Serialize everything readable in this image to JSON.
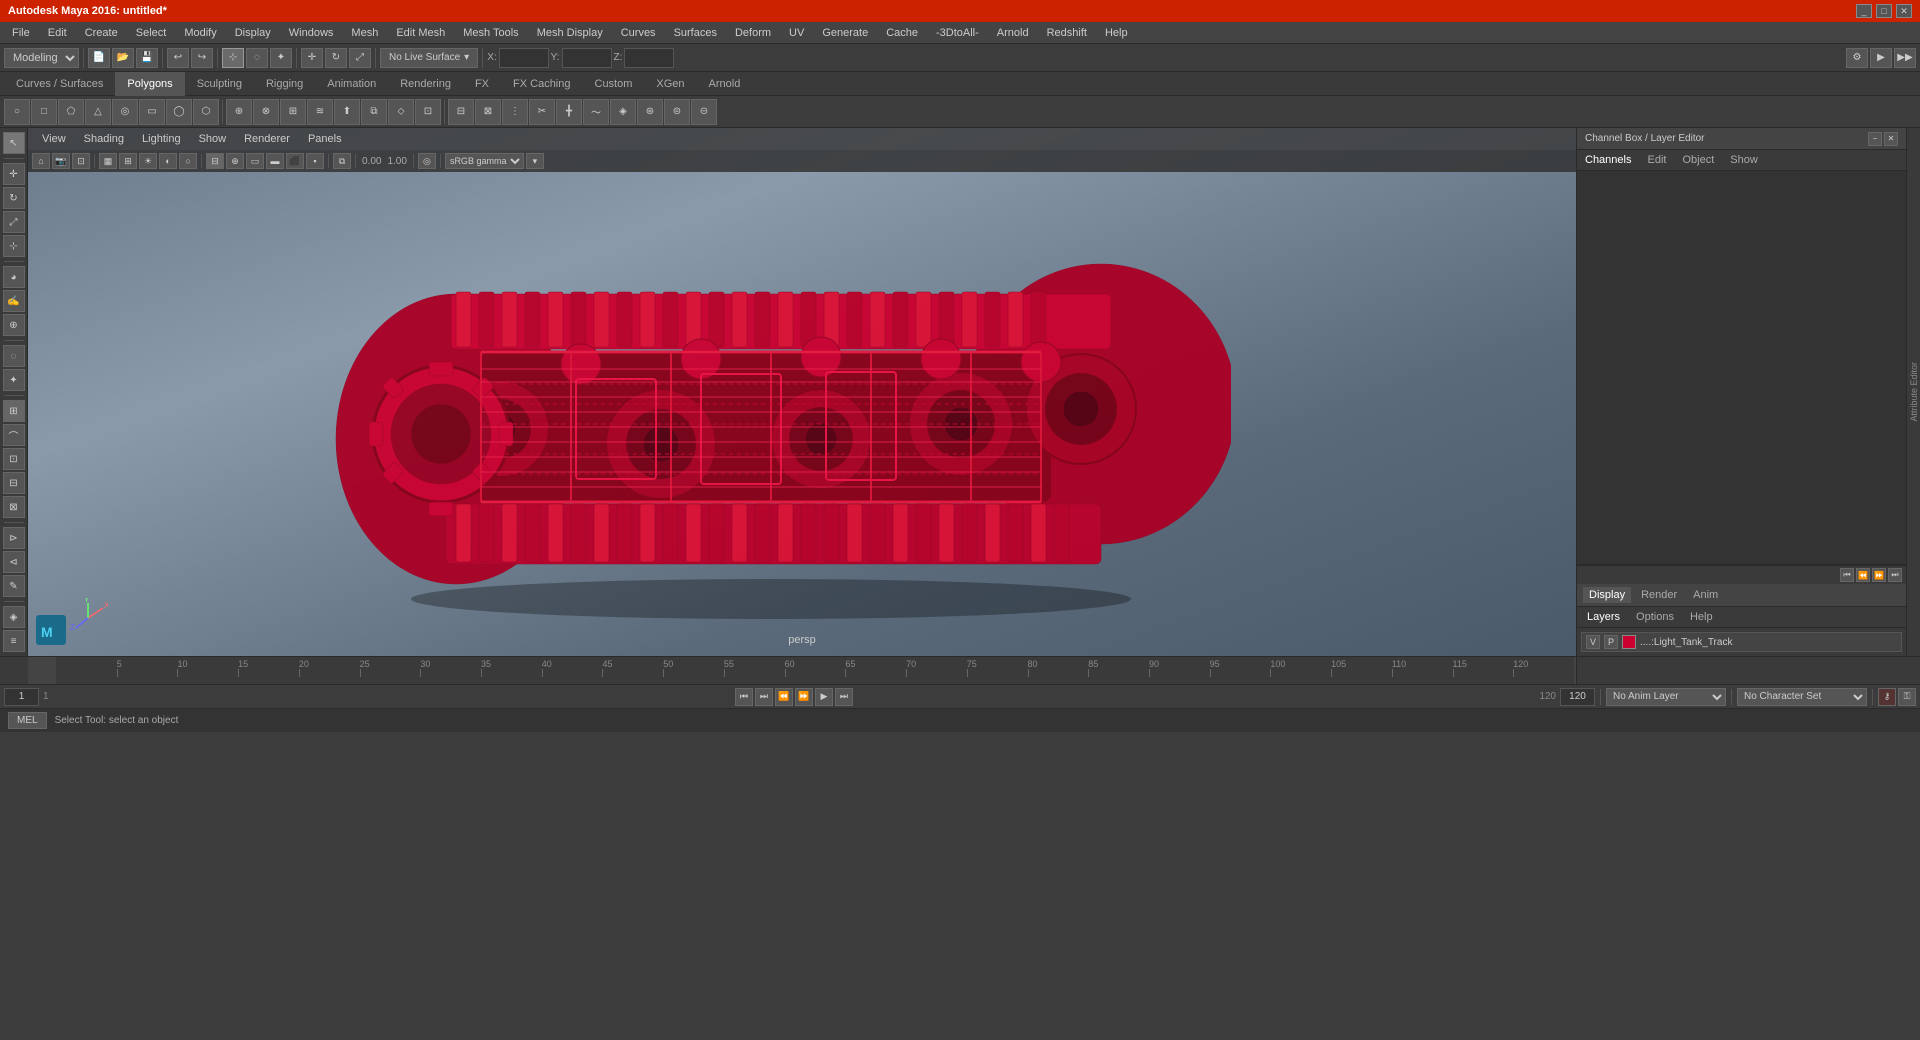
{
  "app": {
    "title": "Autodesk Maya 2016: untitled*",
    "window_controls": [
      "minimize",
      "maximize",
      "close"
    ]
  },
  "menu_bar": {
    "items": [
      "File",
      "Edit",
      "Create",
      "Select",
      "Modify",
      "Display",
      "Windows",
      "Mesh",
      "Edit Mesh",
      "Mesh Tools",
      "Mesh Display",
      "Curves",
      "Surfaces",
      "Deform",
      "UV",
      "Generate",
      "Cache",
      "-3DtoAll-",
      "Arnold",
      "Redshift",
      "Help"
    ]
  },
  "toolbar1": {
    "mode_select": "Modeling",
    "no_live_surface": "No Live Surface",
    "xyz_labels": [
      "X:",
      "Y:",
      "Z:"
    ],
    "custom_label": "Custom"
  },
  "tabs": {
    "items": [
      "Curves / Surfaces",
      "Polygons",
      "Sculpting",
      "Rigging",
      "Animation",
      "Rendering",
      "FX",
      "FX Caching",
      "Custom",
      "XGen",
      "Arnold"
    ]
  },
  "viewport": {
    "menu_items": [
      "View",
      "Shading",
      "Lighting",
      "Show",
      "Renderer",
      "Panels"
    ],
    "label": "persp",
    "gamma_label": "sRGB gamma",
    "coords": {
      "x": "0.00",
      "y": "1.00"
    },
    "lighting_label": "Lighting"
  },
  "right_panel": {
    "title": "Channel Box / Layer Editor",
    "tabs": [
      "Channels",
      "Edit",
      "Object",
      "Show"
    ],
    "lower_tabs": [
      "Display",
      "Render",
      "Anim"
    ],
    "lower_menus": [
      "Layers",
      "Options",
      "Help"
    ],
    "layer": {
      "v": "V",
      "p": "P",
      "name": "....:Light_Tank_Track"
    },
    "cb_controls": [
      "◀◀",
      "◀",
      "▶",
      "▶▶"
    ]
  },
  "attr_editor": {
    "labels": [
      "Attribute Editor",
      "Channel Box / Layer Editor"
    ]
  },
  "timeline": {
    "start": "1",
    "end": "120",
    "ticks": [
      {
        "label": "5",
        "pos": 3
      },
      {
        "label": "10",
        "pos": 6
      },
      {
        "label": "15",
        "pos": 9
      },
      {
        "label": "20",
        "pos": 12
      },
      {
        "label": "25",
        "pos": 15
      },
      {
        "label": "30",
        "pos": 18
      },
      {
        "label": "35",
        "pos": 21
      },
      {
        "label": "40",
        "pos": 24
      },
      {
        "label": "45",
        "pos": 27
      },
      {
        "label": "50",
        "pos": 30
      },
      {
        "label": "55",
        "pos": 33
      },
      {
        "label": "60",
        "pos": 36
      },
      {
        "label": "65",
        "pos": 39
      },
      {
        "label": "70",
        "pos": 42
      },
      {
        "label": "75",
        "pos": 45
      },
      {
        "label": "80",
        "pos": 48
      },
      {
        "label": "85",
        "pos": 51
      },
      {
        "label": "90",
        "pos": 54
      },
      {
        "label": "95",
        "pos": 57
      },
      {
        "label": "100",
        "pos": 60
      },
      {
        "label": "105",
        "pos": 63
      },
      {
        "label": "110",
        "pos": 66
      },
      {
        "label": "115",
        "pos": 69
      },
      {
        "label": "120",
        "pos": 72
      }
    ]
  },
  "transport": {
    "current_frame": "1",
    "range_start": "1",
    "range_end": "120",
    "anim_layer": "No Anim Layer",
    "character_set": "No Character Set",
    "buttons": [
      "⏮",
      "⏭",
      "⏪",
      "⏩",
      "▶",
      "⏹"
    ]
  },
  "status_bar": {
    "mode": "MEL",
    "text": "Select Tool: select an object"
  },
  "model": {
    "object_name": "Light_Tank_Track",
    "color": "#cc0030"
  }
}
